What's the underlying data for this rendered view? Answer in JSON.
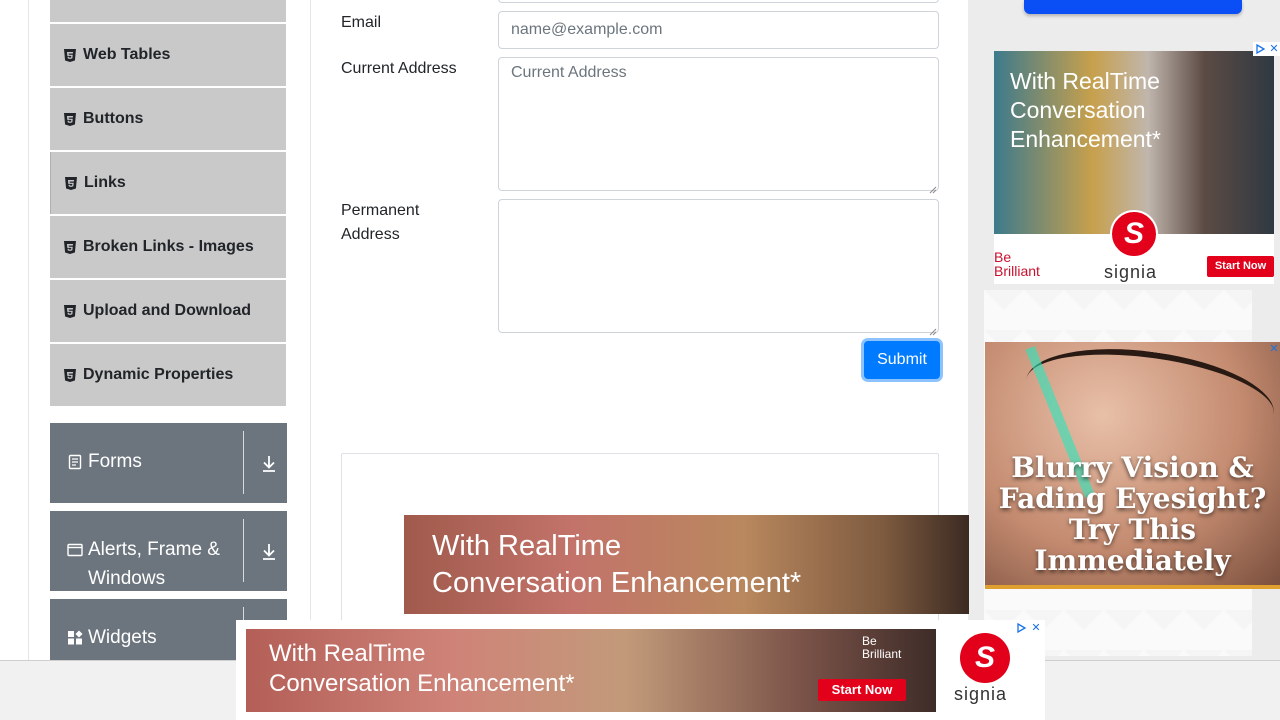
{
  "sidebar": {
    "items": [
      {
        "label": "Web Tables"
      },
      {
        "label": "Buttons"
      },
      {
        "label": "Links"
      },
      {
        "label": "Broken Links - Images"
      },
      {
        "label": "Upload and Download"
      },
      {
        "label": "Dynamic Properties"
      }
    ],
    "item_icon": "html5-icon",
    "groups": [
      {
        "label": "Forms",
        "icon": "form-icon",
        "toggle_icon": "download-arrow-icon"
      },
      {
        "label": "Alerts, Frame &",
        "label_line2": "Windows",
        "icon": "window-icon",
        "toggle_icon": "download-arrow-icon"
      },
      {
        "label": "Widgets",
        "icon": "widgets-icon",
        "toggle_icon": "download-arrow-icon"
      }
    ],
    "colors": {
      "item_bg": "#c9c9c9",
      "group_bg": "#6c757d"
    }
  },
  "form": {
    "email": {
      "label": "Email",
      "placeholder": "name@example.com",
      "value": ""
    },
    "current_address": {
      "label": "Current Address",
      "placeholder": "Current Address",
      "value": ""
    },
    "permanent_address": {
      "label_line1": "Permanent",
      "label_line2": "Address",
      "value": ""
    },
    "submit_label": "Submit",
    "accent": "#007bff"
  },
  "ads": {
    "right_top": {
      "headline_1": "With RealTime",
      "headline_2": "Conversation",
      "headline_3": "Enhancement*",
      "brand_left_1": "Be",
      "brand_left_2": "Brilliant",
      "logo_glyph": "S",
      "logo_word": "signia",
      "cta": "Start Now"
    },
    "right_middle": {
      "line_1": "Blurry Vision &",
      "line_2": "Fading Eyesight?",
      "line_3": "Try This",
      "line_4": "Immediately"
    },
    "center_banner": {
      "line_1": "With RealTime",
      "line_2": "Conversation Enhancement*"
    },
    "bottom_banner": {
      "line_1": "With RealTime",
      "line_2": "Conversation Enhancement*",
      "be_1": "Be",
      "be_2": "Brilliant",
      "cta": "Start Now",
      "logo_glyph": "S",
      "logo_word": "signia"
    },
    "close_glyph": "✕",
    "adchoices_icon": "adchoices-icon"
  }
}
